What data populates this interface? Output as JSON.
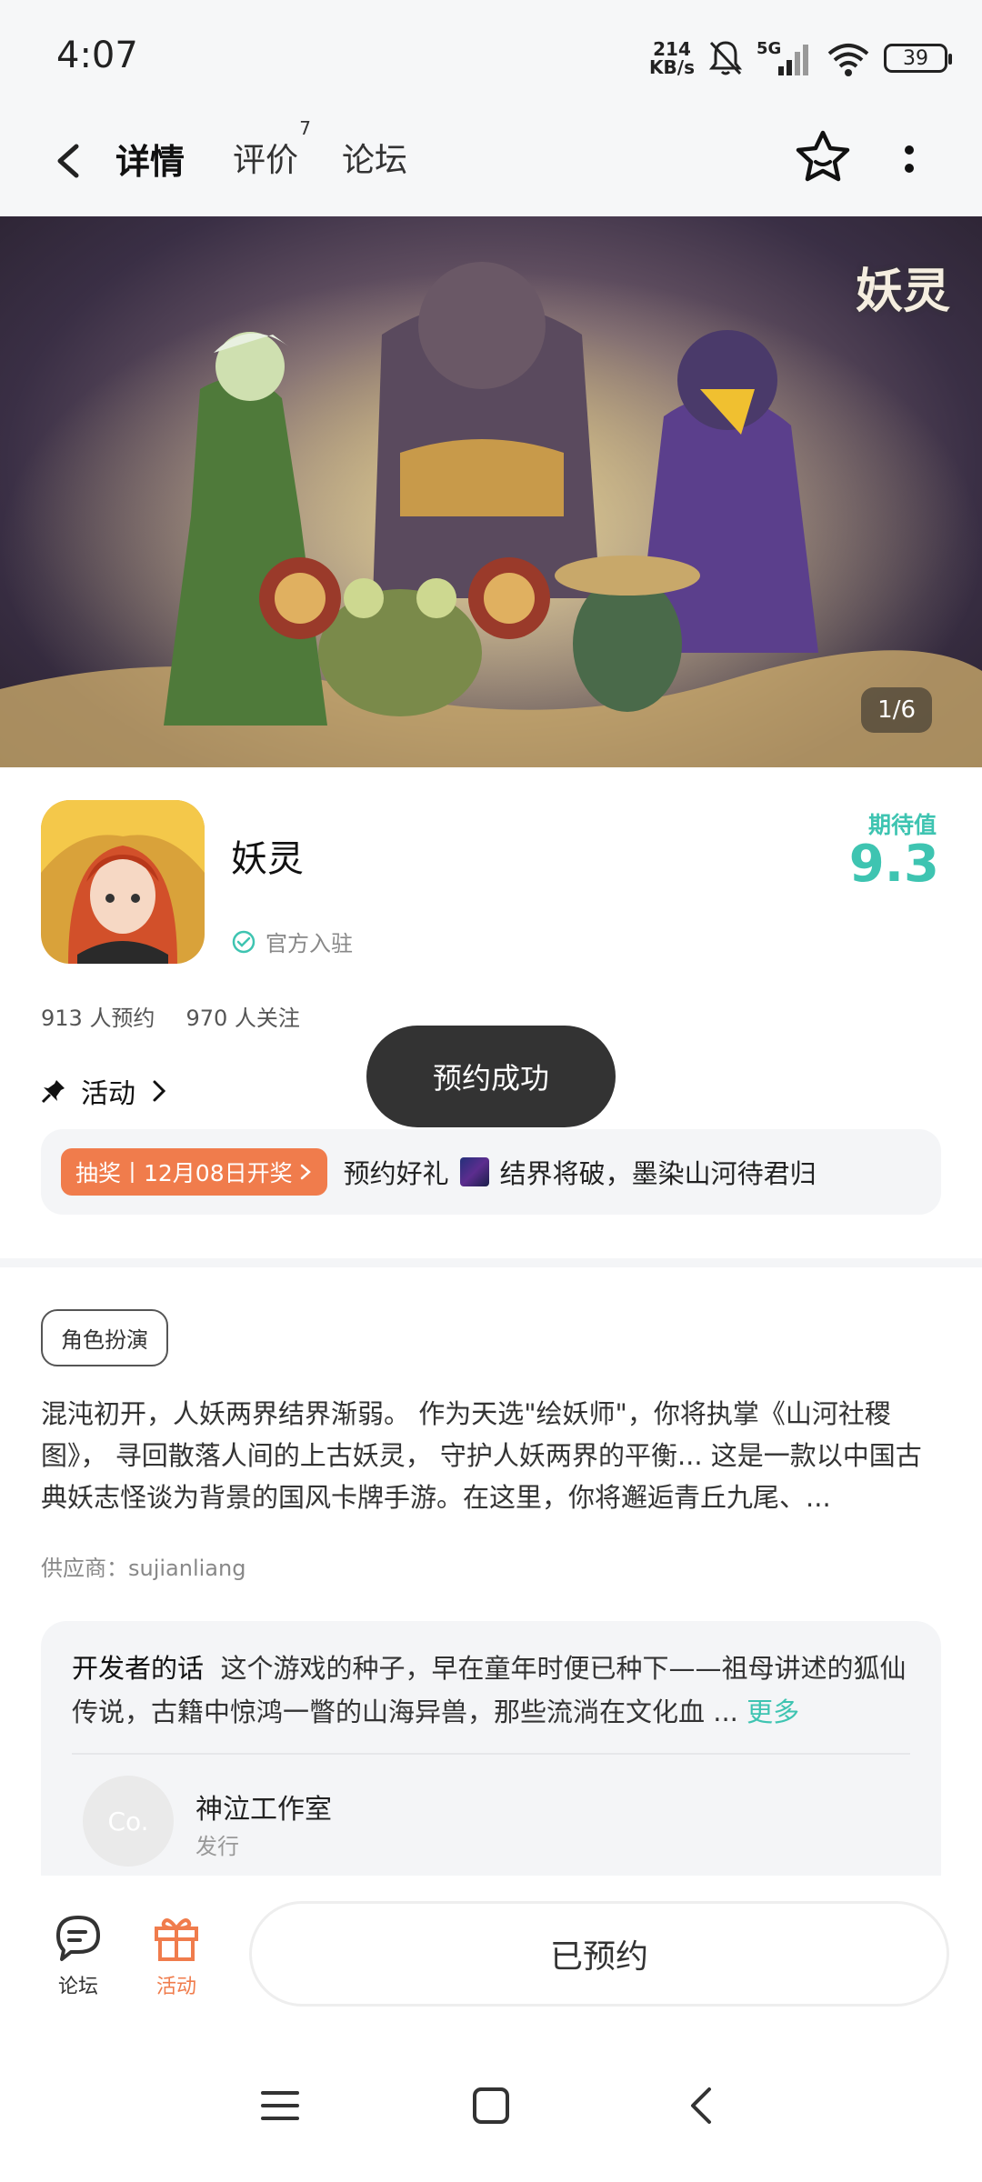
{
  "status": {
    "time": "4:07",
    "net_speed_value": "214",
    "net_speed_unit": "KB/s",
    "network": "5G",
    "battery": "39"
  },
  "nav": {
    "tabs": [
      {
        "label": "详情"
      },
      {
        "label": "评价",
        "badge": "7"
      },
      {
        "label": "论坛"
      }
    ]
  },
  "banner": {
    "logo_text": "妖灵",
    "counter": "1/6"
  },
  "game": {
    "name": "妖灵",
    "official_label": "官方入驻",
    "expect_label": "期待值",
    "expect_score": "9.3",
    "reservations": "913 人预约",
    "followers": "970 人关注"
  },
  "activity": {
    "section_title": "活动",
    "badge": "抽奖丨12月08日开奖",
    "text_prefix": "预约好礼",
    "text_suffix": "结界将破，墨染山河待君归"
  },
  "toast": "预约成功",
  "genre_tag": "角色扮演",
  "description": "混沌初开，人妖两界结界渐弱。 作为天选\"绘妖师\"，你将执掌《山河社稷图》， 寻回散落人间的上古妖灵， 守护人妖两界的平衡... 这是一款以中国古典妖志怪谈为背景的国风卡牌手游。在这里，你将邂逅青丘九尾、...",
  "supplier": "供应商：sujianliang",
  "developer": {
    "label": "开发者的话",
    "text": "这个游戏的种子，早在童年时便已种下——祖母讲述的狐仙传说，古籍中惊鸿一瞥的山海异兽，那些流淌在文化血 ...",
    "more": "更多",
    "studio_avatar": "Co.",
    "studio_name": "神泣工作室",
    "studio_role": "发行"
  },
  "bottom": {
    "forum_label": "论坛",
    "activity_label": "活动",
    "reserved_label": "已预约"
  },
  "colors": {
    "accent": "#3ec4b1",
    "orange": "#f07c4c",
    "toast_bg": "#333333"
  }
}
